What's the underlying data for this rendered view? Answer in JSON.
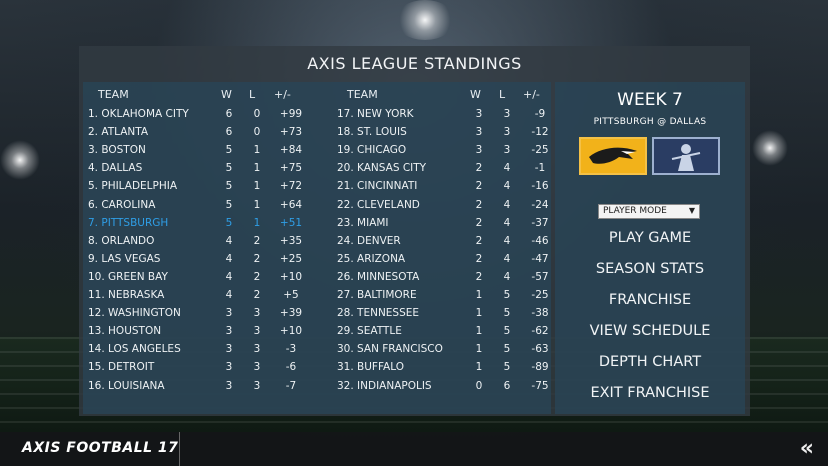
{
  "title": "AXIS LEAGUE STANDINGS",
  "columns": {
    "team": "TEAM",
    "w": "W",
    "l": "L",
    "pm": "+/-"
  },
  "left_teams": [
    {
      "team": "1. OKLAHOMA CITY",
      "w": "6",
      "l": "0",
      "pm": "+99"
    },
    {
      "team": "2. ATLANTA",
      "w": "6",
      "l": "0",
      "pm": "+73"
    },
    {
      "team": "3. BOSTON",
      "w": "5",
      "l": "1",
      "pm": "+84"
    },
    {
      "team": "4. DALLAS",
      "w": "5",
      "l": "1",
      "pm": "+75"
    },
    {
      "team": "5. PHILADELPHIA",
      "w": "5",
      "l": "1",
      "pm": "+72"
    },
    {
      "team": "6. CAROLINA",
      "w": "5",
      "l": "1",
      "pm": "+64"
    },
    {
      "team": "7. PITTSBURGH",
      "w": "5",
      "l": "1",
      "pm": "+51",
      "highlight": true
    },
    {
      "team": "8. ORLANDO",
      "w": "4",
      "l": "2",
      "pm": "+35"
    },
    {
      "team": "9. LAS VEGAS",
      "w": "4",
      "l": "2",
      "pm": "+25"
    },
    {
      "team": "10. GREEN BAY",
      "w": "4",
      "l": "2",
      "pm": "+10"
    },
    {
      "team": "11. NEBRASKA",
      "w": "4",
      "l": "2",
      "pm": "+5"
    },
    {
      "team": "12. WASHINGTON",
      "w": "3",
      "l": "3",
      "pm": "+39"
    },
    {
      "team": "13. HOUSTON",
      "w": "3",
      "l": "3",
      "pm": "+10"
    },
    {
      "team": "14. LOS ANGELES",
      "w": "3",
      "l": "3",
      "pm": "-3"
    },
    {
      "team": "15. DETROIT",
      "w": "3",
      "l": "3",
      "pm": "-6"
    },
    {
      "team": "16. LOUISIANA",
      "w": "3",
      "l": "3",
      "pm": "-7"
    }
  ],
  "right_teams": [
    {
      "team": "17. NEW YORK",
      "w": "3",
      "l": "3",
      "pm": "-9"
    },
    {
      "team": "18. ST. LOUIS",
      "w": "3",
      "l": "3",
      "pm": "-12"
    },
    {
      "team": "19. CHICAGO",
      "w": "3",
      "l": "3",
      "pm": "-25"
    },
    {
      "team": "20. KANSAS CITY",
      "w": "2",
      "l": "4",
      "pm": "-1"
    },
    {
      "team": "21. CINCINNATI",
      "w": "2",
      "l": "4",
      "pm": "-16"
    },
    {
      "team": "22. CLEVELAND",
      "w": "2",
      "l": "4",
      "pm": "-24"
    },
    {
      "team": "23. MIAMI",
      "w": "2",
      "l": "4",
      "pm": "-37"
    },
    {
      "team": "24. DENVER",
      "w": "2",
      "l": "4",
      "pm": "-46"
    },
    {
      "team": "25. ARIZONA",
      "w": "2",
      "l": "4",
      "pm": "-47"
    },
    {
      "team": "26. MINNESOTA",
      "w": "2",
      "l": "4",
      "pm": "-57"
    },
    {
      "team": "27. BALTIMORE",
      "w": "1",
      "l": "5",
      "pm": "-25"
    },
    {
      "team": "28. TENNESSEE",
      "w": "1",
      "l": "5",
      "pm": "-38"
    },
    {
      "team": "29. SEATTLE",
      "w": "1",
      "l": "5",
      "pm": "-62"
    },
    {
      "team": "30. SAN FRANCISCO",
      "w": "1",
      "l": "5",
      "pm": "-63"
    },
    {
      "team": "31. BUFFALO",
      "w": "1",
      "l": "5",
      "pm": "-89"
    },
    {
      "team": "32. INDIANAPOLIS",
      "w": "0",
      "l": "6",
      "pm": "-75"
    }
  ],
  "side": {
    "week": "WEEK 7",
    "matchup": "PITTSBURGH  @  DALLAS",
    "mode_select": "PLAYER MODE",
    "menu": [
      "PLAY GAME",
      "SEASON STATS",
      "FRANCHISE",
      "VIEW SCHEDULE",
      "DEPTH CHART",
      "EXIT FRANCHISE"
    ]
  },
  "footer": {
    "title": "AXIS FOOTBALL 17"
  },
  "colors": {
    "highlight": "#2f9ee6",
    "home_logo": "#f2b21a",
    "away_logo": "#2a3d63"
  }
}
